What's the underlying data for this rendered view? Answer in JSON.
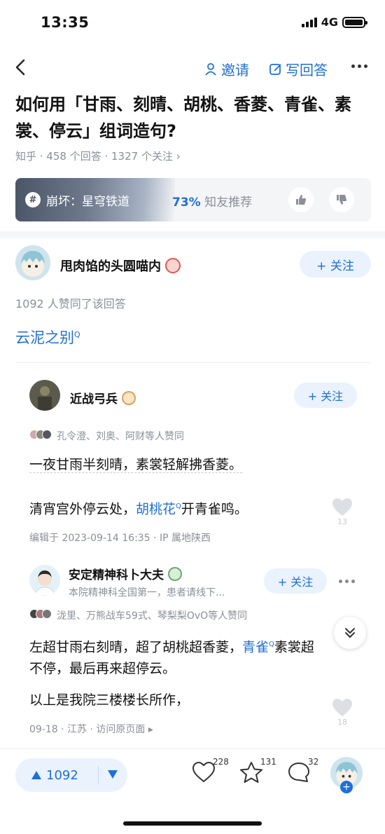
{
  "status": {
    "time": "13:35",
    "network": "4G"
  },
  "nav": {
    "invite_label": "邀请",
    "write_label": "写回答"
  },
  "question": {
    "title": "如何用「甘雨、刻晴、胡桃、香菱、青雀、素裳、停云」组词造句?",
    "meta": "知乎 · 458 个回答 · 1327 个关注 ›"
  },
  "banner": {
    "tag": "崩坏：星穹铁道",
    "percent": "73%",
    "recommend": "知友推荐"
  },
  "answer": {
    "author": "甩肉馅的头圆喵内",
    "follow_label": "+ 关注",
    "agree_text": "1092 人赞同了该回答",
    "content": "云泥之别"
  },
  "comments": [
    {
      "author": "近战弓兵",
      "follow_label": "+ 关注",
      "likers": "孔令澄、刘奥、阿财等人赞同",
      "line1": "一夜甘雨半刻晴，素裳轻解拂香菱。",
      "line2_pre": "清宵宫外停云处，",
      "line2_link": "胡桃花",
      "line2_post": "开青雀鸣。",
      "meta": "编辑于 2023-09-14 16:35 · IP 属地陕西",
      "likes": "13"
    },
    {
      "author": "安定精神科卜大夫",
      "subtitle": "本院精神科全国第一，患者请线下...",
      "follow_label": "+ 关注",
      "likers": "泷里、万熊战车59式、琴梨梨OvO等人赞同",
      "line1_pre": "左超甘雨右刻晴，超了胡桃超香菱，",
      "line1_link": "青雀",
      "line1_post": "素裳超",
      "line2": "不停，最后再来超停云。",
      "line3": "以上是我院三楼楼长所作，",
      "meta": "09-18 · 江苏 · 访问原页面 ▸",
      "likes": "18"
    }
  ],
  "bottom": {
    "vote_count": "1092",
    "likes_count": "228",
    "favorites_count": "131",
    "comments_count": "32"
  },
  "colors": {
    "accent": "#1f6fd6",
    "accent_bg": "#eaf2fd"
  }
}
